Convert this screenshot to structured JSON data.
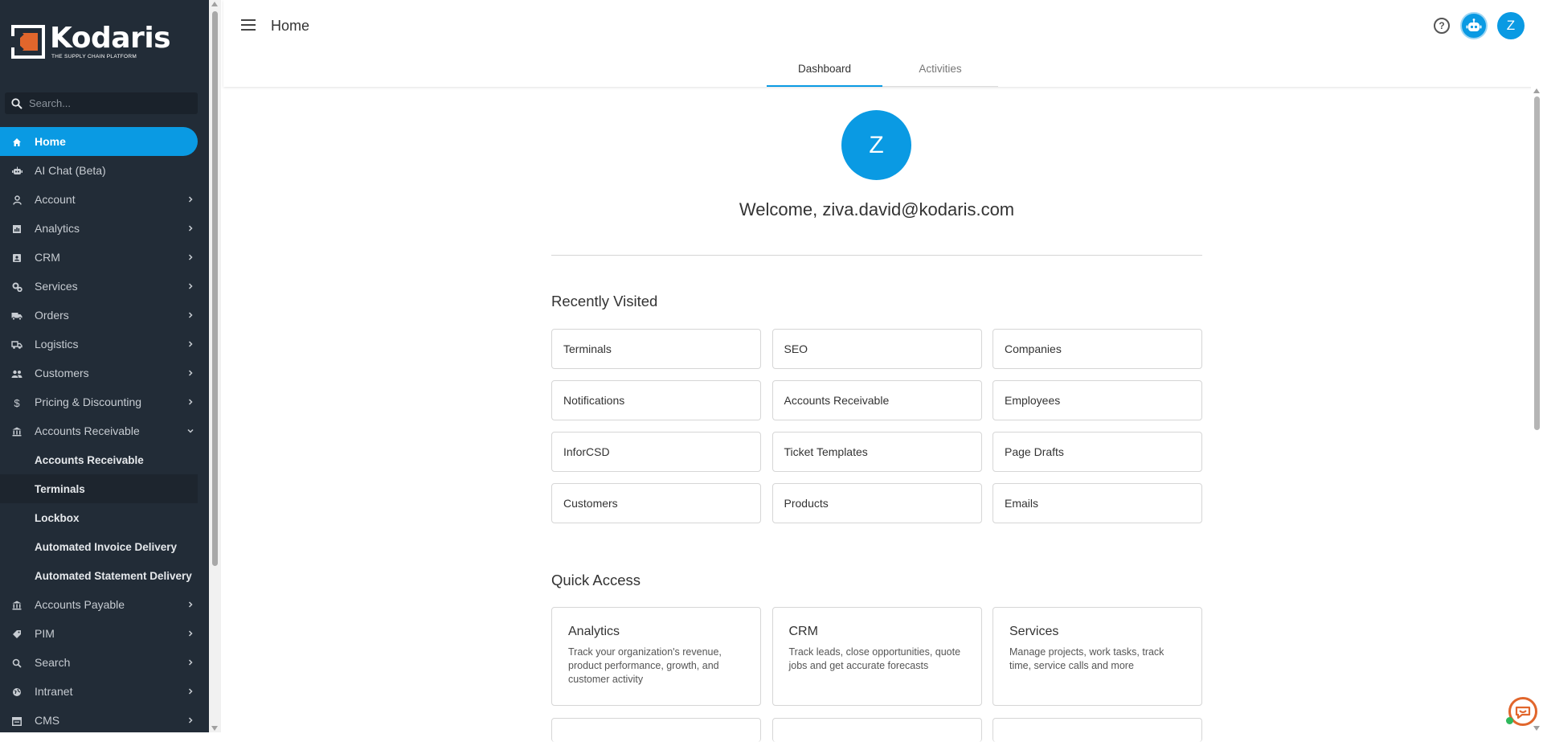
{
  "brand": {
    "name": "Kodaris",
    "tagline": "THE SUPPLY CHAIN PLATFORM",
    "logo_color": "#e1662c",
    "accent": "#0a9ae3"
  },
  "sidebar": {
    "search_placeholder": "Search...",
    "items": [
      {
        "label": "Home",
        "icon": "home-icon",
        "active": true
      },
      {
        "label": "AI Chat (Beta)",
        "icon": "robot-icon"
      },
      {
        "label": "Account",
        "icon": "user-icon",
        "chevron": "right"
      },
      {
        "label": "Analytics",
        "icon": "chart-icon",
        "chevron": "right"
      },
      {
        "label": "CRM",
        "icon": "contact-card-icon",
        "chevron": "right"
      },
      {
        "label": "Services",
        "icon": "gears-icon",
        "chevron": "right"
      },
      {
        "label": "Orders",
        "icon": "truck-icon",
        "chevron": "right"
      },
      {
        "label": "Logistics",
        "icon": "delivery-icon",
        "chevron": "right"
      },
      {
        "label": "Customers",
        "icon": "people-icon",
        "chevron": "right"
      },
      {
        "label": "Pricing & Discounting",
        "icon": "dollar-icon",
        "chevron": "right"
      },
      {
        "label": "Accounts Receivable",
        "icon": "bank-icon",
        "chevron": "down"
      }
    ],
    "sub_items": [
      "Accounts Receivable",
      "Terminals",
      "Lockbox",
      "Automated Invoice Delivery",
      "Automated Statement Delivery"
    ],
    "items_after": [
      {
        "label": "Accounts Payable",
        "icon": "bank-icon",
        "chevron": "right"
      },
      {
        "label": "PIM",
        "icon": "tag-icon",
        "chevron": "right"
      },
      {
        "label": "Search",
        "icon": "search-icon",
        "chevron": "right"
      },
      {
        "label": "Intranet",
        "icon": "globe-icon",
        "chevron": "right"
      },
      {
        "label": "CMS",
        "icon": "window-icon",
        "chevron": "right"
      }
    ]
  },
  "header": {
    "title": "Home",
    "help": "?",
    "avatar_letter": "Z"
  },
  "tabs": [
    {
      "label": "Dashboard",
      "active": true
    },
    {
      "label": "Activities"
    }
  ],
  "main": {
    "avatar_letter": "Z",
    "welcome": "Welcome, ziva.david@kodaris.com",
    "recently_visited_title": "Recently Visited",
    "recently_visited": [
      "Terminals",
      "SEO",
      "Companies",
      "Notifications",
      "Accounts Receivable",
      "Employees",
      "InforCSD",
      "Ticket Templates",
      "Page Drafts",
      "Customers",
      "Products",
      "Emails"
    ],
    "quick_access_title": "Quick Access",
    "quick_access": [
      {
        "title": "Analytics",
        "desc": "Track your organization's revenue, product performance, growth, and customer activity"
      },
      {
        "title": "CRM",
        "desc": "Track leads, close opportunities, quote jobs and get accurate forecasts"
      },
      {
        "title": "Services",
        "desc": "Manage projects, work tasks, track time, service calls and more"
      }
    ]
  }
}
